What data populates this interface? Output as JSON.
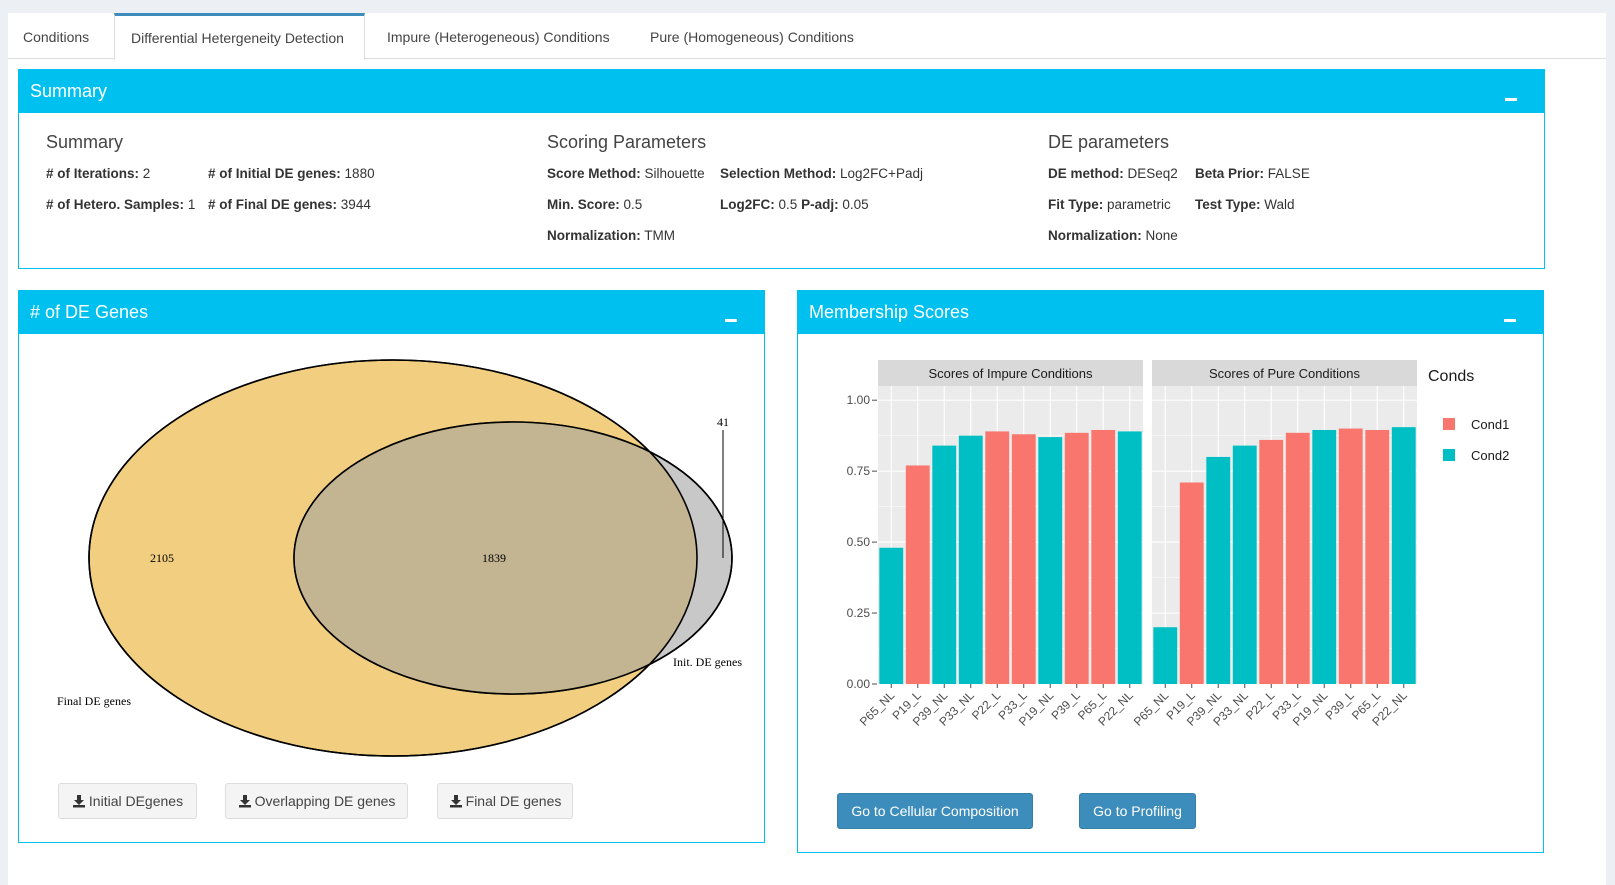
{
  "tabs": [
    {
      "label": "Conditions",
      "active": false
    },
    {
      "label": "Differential Hetergeneity Detection",
      "active": true
    },
    {
      "label": "Impure (Heterogeneous) Conditions",
      "active": false
    },
    {
      "label": "Pure (Homogeneous) Conditions",
      "active": false
    }
  ],
  "summary_box": {
    "title": "Summary",
    "summary": {
      "heading": "Summary",
      "iterations_label": "# of Iterations:",
      "iterations_value": "2",
      "initial_de_label": "# of Initial DE genes:",
      "initial_de_value": "1880",
      "hetero_label": "# of Hetero. Samples:",
      "hetero_value": "1",
      "final_de_label": "# of Final DE genes:",
      "final_de_value": "3944"
    },
    "scoring": {
      "heading": "Scoring Parameters",
      "score_method_label": "Score Method:",
      "score_method_value": "Silhouette",
      "selection_method_label": "Selection Method:",
      "selection_method_value": "Log2FC+Padj",
      "min_score_label": "Min. Score:",
      "min_score_value": "0.5",
      "log2fc_label": "Log2FC:",
      "log2fc_value": "0.5",
      "padj_label": "P-adj:",
      "padj_value": "0.05",
      "normalization_label": "Normalization:",
      "normalization_value": "TMM"
    },
    "de_params": {
      "heading": "DE parameters",
      "de_method_label": "DE method:",
      "de_method_value": "DESeq2",
      "beta_prior_label": "Beta Prior:",
      "beta_prior_value": "FALSE",
      "fit_type_label": "Fit Type:",
      "fit_type_value": "parametric",
      "test_type_label": "Test Type:",
      "test_type_value": "Wald",
      "normalization_label": "Normalization:",
      "normalization_value": "None"
    }
  },
  "de_genes_box": {
    "title": "# of DE Genes",
    "venn": {
      "final_only": "2105",
      "overlap": "1839",
      "initial_only": "41",
      "final_label": "Final DE genes",
      "initial_label": "Init. DE genes"
    },
    "buttons": {
      "initial": "Initial DEgenes",
      "overlapping": "Overlapping DE genes",
      "final": "Final DE genes"
    }
  },
  "membership_box": {
    "title": "Membership Scores",
    "buttons": {
      "cellular": "Go to Cellular Composition",
      "profiling": "Go to Profiling"
    }
  },
  "chart_data": {
    "type": "bar",
    "ylim": [
      0,
      1.05
    ],
    "yticks": [
      "0.00",
      "0.25",
      "0.50",
      "0.75",
      "1.00"
    ],
    "legend_title": "Conds",
    "legend": [
      {
        "name": "Cond1",
        "color": "#F8766D"
      },
      {
        "name": "Cond2",
        "color": "#00BFC4"
      }
    ],
    "panels": [
      {
        "title": "Scores of Impure Conditions",
        "categories": [
          "P65_NL",
          "P19_L",
          "P39_NL",
          "P33_NL",
          "P22_L",
          "P33_L",
          "P19_NL",
          "P39_L",
          "P65_L",
          "P22_NL"
        ],
        "values": [
          0.48,
          0.77,
          0.84,
          0.875,
          0.89,
          0.88,
          0.87,
          0.885,
          0.895,
          0.89
        ],
        "groups": [
          "Cond2",
          "Cond1",
          "Cond2",
          "Cond2",
          "Cond1",
          "Cond1",
          "Cond2",
          "Cond1",
          "Cond1",
          "Cond2"
        ]
      },
      {
        "title": "Scores of Pure Conditions",
        "categories": [
          "P65_NL",
          "P19_L",
          "P39_NL",
          "P33_NL",
          "P22_L",
          "P33_L",
          "P19_NL",
          "P39_L",
          "P65_L",
          "P22_NL"
        ],
        "values": [
          0.2,
          0.71,
          0.8,
          0.84,
          0.86,
          0.885,
          0.895,
          0.9,
          0.895,
          0.905
        ],
        "groups": [
          "Cond2",
          "Cond1",
          "Cond2",
          "Cond2",
          "Cond1",
          "Cond1",
          "Cond2",
          "Cond1",
          "Cond1",
          "Cond2"
        ]
      }
    ]
  }
}
